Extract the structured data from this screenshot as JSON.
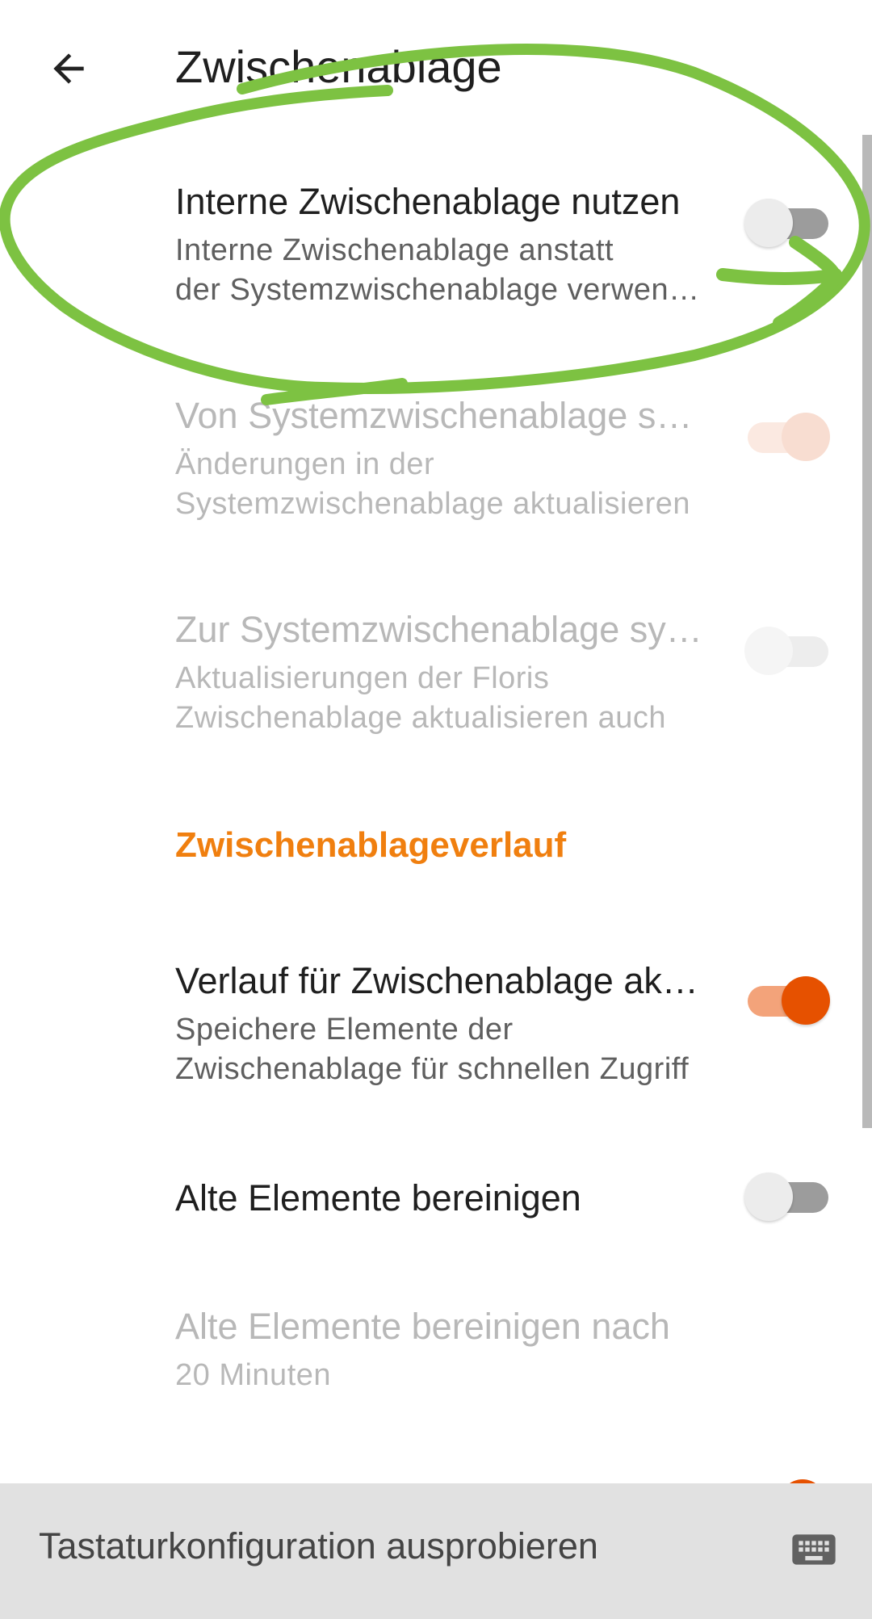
{
  "header": {
    "title": "Zwischenablage",
    "back_icon": "arrow-back-icon"
  },
  "preferences": [
    {
      "title": "Interne Zwischenablage nutzen",
      "summary_line1": "Interne Zwischenablage anstatt",
      "summary_line2": "der Systemzwischenablage verwenden",
      "switch": "off",
      "enabled": true
    },
    {
      "title": "Von Systemzwischenablage synchronisieren",
      "summary_line1": "Änderungen in der",
      "summary_line2": "Systemzwischenablage aktualisieren",
      "switch": "on",
      "enabled": false
    },
    {
      "title": "Zur Systemzwischenablage synchronisieren",
      "summary_line1": "Aktualisierungen der Floris",
      "summary_line2": "Zwischenablage aktualisieren auch",
      "switch": "off",
      "enabled": false
    }
  ],
  "history_section": {
    "header": "Zwischenablageverlauf",
    "items": [
      {
        "title": "Verlauf für Zwischenablage aktivieren",
        "summary_line1": "Speichere Elemente der",
        "summary_line2": "Zwischenablage für schnellen Zugriff",
        "switch": "on",
        "enabled": true
      },
      {
        "title": "Alte Elemente bereinigen",
        "switch": "off",
        "enabled": true
      },
      {
        "title": "Alte Elemente bereinigen nach",
        "summary": "20 Minuten",
        "enabled": false
      }
    ]
  },
  "bottom_bar": {
    "input_text": "Tastaturkonfiguration ausprobieren",
    "icon": "keyboard-icon"
  },
  "colors": {
    "accent": "#e65100",
    "section_header": "#f07f0f",
    "annotation": "#7dc242"
  }
}
